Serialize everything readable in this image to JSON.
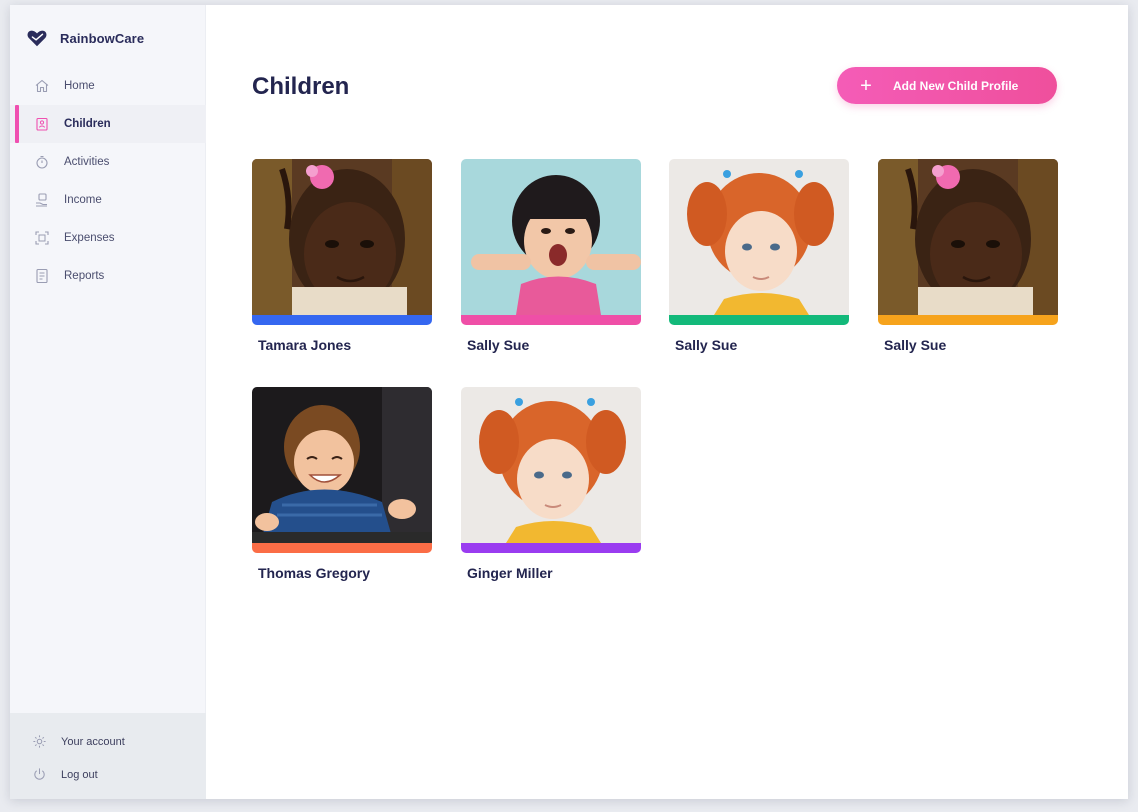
{
  "app": {
    "name": "RainbowCare"
  },
  "sidebar": {
    "items": [
      {
        "label": "Home",
        "icon": "home-icon"
      },
      {
        "label": "Children",
        "icon": "children-icon",
        "active": true
      },
      {
        "label": "Activities",
        "icon": "timer-icon"
      },
      {
        "label": "Income",
        "icon": "income-icon"
      },
      {
        "label": "Expenses",
        "icon": "receipt-icon"
      },
      {
        "label": "Reports",
        "icon": "document-icon"
      }
    ],
    "account": {
      "label": "Your account",
      "icon": "gear-icon"
    },
    "logout": {
      "label": "Log out",
      "icon": "power-icon"
    }
  },
  "page": {
    "title": "Children",
    "add_button": {
      "icon": "+",
      "label": "Add New Child Profile"
    }
  },
  "children": [
    {
      "name": "Tamara Jones",
      "bar_color": "#3567f0",
      "photo": "girl-pink-bow-photo"
    },
    {
      "name": "Sally Sue",
      "bar_color": "#ef4fa7",
      "photo": "girl-funny-face-photo"
    },
    {
      "name": "Sally Sue",
      "bar_color": "#13b97a",
      "photo": "redhead-girl-photo"
    },
    {
      "name": "Sally Sue",
      "bar_color": "#f6a31c",
      "photo": "girl-pink-bow-photo"
    },
    {
      "name": "Thomas Gregory",
      "bar_color": "#fb6d46",
      "photo": "toddler-blue-sweater-photo"
    },
    {
      "name": "Ginger Miller",
      "bar_color": "#9a3cf0",
      "photo": "redhead-girl-photo"
    }
  ],
  "colors": {
    "accent": "#ef4fb0",
    "brand_dark": "#2a2c5b",
    "background": "#f5f6fa"
  }
}
